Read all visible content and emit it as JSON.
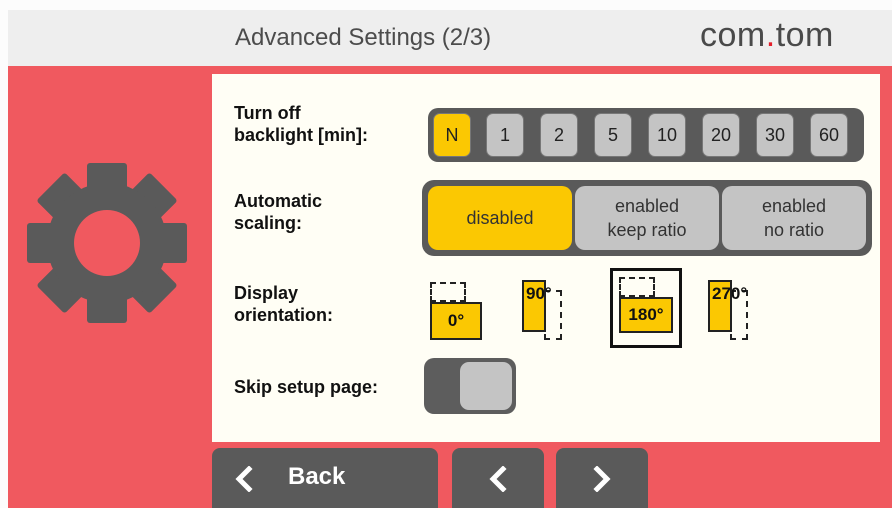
{
  "header": {
    "title": "Advanced Settings (2/3)",
    "brand_prefix": "com",
    "brand_dot": ".",
    "brand_suffix": "tom"
  },
  "settings": {
    "backlight": {
      "label_line1": "Turn off",
      "label_line2": "backlight [min]:",
      "options": [
        "N",
        "1",
        "2",
        "5",
        "10",
        "20",
        "30",
        "60"
      ],
      "selected": "N"
    },
    "scaling": {
      "label_line1": "Automatic",
      "label_line2": "scaling:",
      "options": [
        {
          "line1": "disabled",
          "line2": ""
        },
        {
          "line1": "enabled",
          "line2": "keep ratio"
        },
        {
          "line1": "enabled",
          "line2": "no ratio"
        }
      ],
      "selected": "disabled"
    },
    "orientation": {
      "label_line1": "Display",
      "label_line2": "orientation:",
      "options": [
        "0°",
        "90°",
        "180°",
        "270°"
      ],
      "selected": "180°"
    },
    "skip_setup": {
      "label": "Skip setup page:",
      "value": "off"
    }
  },
  "nav": {
    "back_label": "Back"
  },
  "colors": {
    "accent": "#fbc802",
    "background": "#f0595f",
    "dark": "#5a5a5a",
    "inactive": "#c4c4c4",
    "brand_dot": "#e41e2a"
  },
  "icons": {
    "settings": "gear-icon",
    "back": "chevron-left-icon",
    "prev": "chevron-left-icon",
    "next": "chevron-right-icon"
  }
}
